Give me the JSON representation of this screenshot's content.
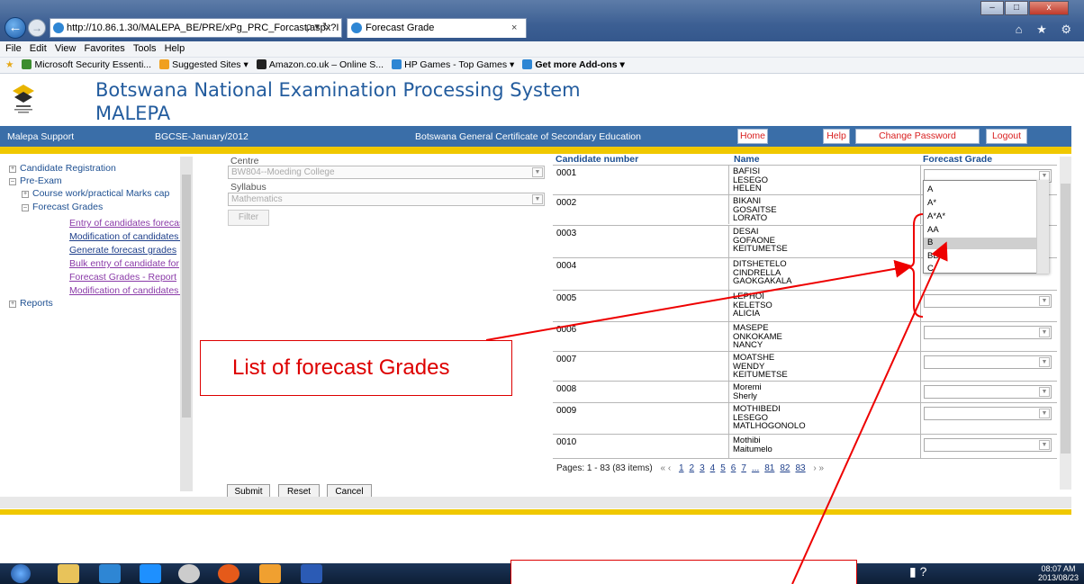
{
  "browser": {
    "url": "http://10.86.1.30/MALEPA_BE/PRE/xPg_PRC_Forcast.aspx?I",
    "url_controls": "ρ ▾ ↻",
    "tab_title": "Forecast Grade",
    "tab_close": "×",
    "back": "←",
    "forward": "→",
    "window_controls": [
      "–",
      "□",
      "x"
    ],
    "right_icons": "⌂ ★ ⚙",
    "menu": [
      "File",
      "Edit",
      "View",
      "Favorites",
      "Tools",
      "Help"
    ],
    "favorites": [
      "Microsoft Security Essenti...",
      "Suggested Sites ▾",
      "Amazon.co.uk – Online S...",
      "HP Games - Top Games ▾",
      "Get more Add-ons ▾"
    ]
  },
  "header": {
    "title_line1": "Botswana National Examination Processing System",
    "title_line2": "MALEPA"
  },
  "navbar": {
    "support": "Malepa Support",
    "session": "BGCSE-January/2012",
    "qualification": "Botswana General Certificate of Secondary Education",
    "home": "Home",
    "help": "Help",
    "change_password": "Change Password",
    "logout": "Logout"
  },
  "tree": {
    "candidate_registration": "Candidate Registration",
    "pre_exam": "Pre-Exam",
    "course_work": "Course work/practical Marks cap",
    "forecast_grades": "Forecast Grades",
    "items": [
      "Entry of candidates forecas",
      "Modification of candidates f",
      "Generate forecast grades",
      "Bulk entry of candidate for",
      "Forecast Grades - Report",
      "Modification of candidates f"
    ],
    "reports": "Reports"
  },
  "form": {
    "centre_label": "Centre",
    "centre_value": "BW804--Moeding College",
    "syllabus_label": "Syllabus",
    "syllabus_value": "Mathematics",
    "filter": "Filter"
  },
  "grid": {
    "headers": [
      "Candidate number",
      "Name",
      "Forecast Grade"
    ],
    "rows": [
      {
        "num": "0001",
        "name": [
          "BAFISI",
          "LESEGO",
          "HELEN"
        ]
      },
      {
        "num": "0002",
        "name": [
          "BIKANI",
          "GOSAITSE",
          "LORATO"
        ]
      },
      {
        "num": "0003",
        "name": [
          "DESAI",
          "GOFAONE",
          "KEITUMETSE"
        ]
      },
      {
        "num": "0004",
        "name": [
          "DITSHETELO",
          "CINDRELLA",
          "GAOKGAKALA"
        ]
      },
      {
        "num": "0005",
        "name": [
          "LEPHOI",
          "KELETSO",
          "ALICIA"
        ]
      },
      {
        "num": "0006",
        "name": [
          "MASEPE",
          "ONKOKAME",
          "NANCY"
        ]
      },
      {
        "num": "0007",
        "name": [
          "MOATSHE",
          "WENDY",
          "KEITUMETSE"
        ]
      },
      {
        "num": "0008",
        "name": [
          "Moremi",
          "Sherly",
          ""
        ]
      },
      {
        "num": "0009",
        "name": [
          "MOTHIBEDI",
          "LESEGO",
          "MATLHOGONOLO"
        ]
      },
      {
        "num": "0010",
        "name": [
          "Mothibi",
          "Maitumelo",
          ""
        ]
      }
    ],
    "pager_text": "Pages: 1 - 83 (83 items)",
    "pager_prev": "« ‹",
    "pager_next": "› »",
    "pager_pages": [
      "1",
      "2",
      "3",
      "4",
      "5",
      "6",
      "7",
      "...",
      "81",
      "82",
      "83"
    ]
  },
  "dropdown": {
    "options": [
      "A",
      "A*",
      "A*A*",
      "AA",
      "B",
      "BB",
      "C"
    ],
    "selected": "B"
  },
  "actions": {
    "submit": "Submit",
    "reset": "Reset",
    "cancel": "Cancel"
  },
  "annotation": {
    "label": "List of forecast Grades"
  },
  "taskbar": {
    "time": "08:07 AM",
    "date": "2013/08/23"
  },
  "colors": {
    "header_blue": "#235c9e",
    "nav_blue": "#3a6ea8",
    "accent_yellow": "#f0c800",
    "annotation_red": "#dd0000"
  }
}
